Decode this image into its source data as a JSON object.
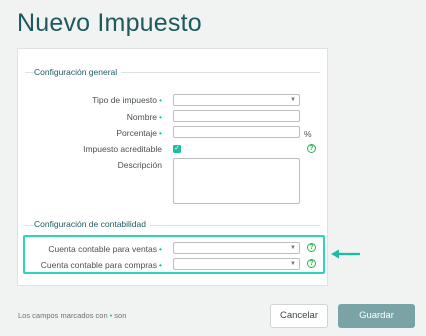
{
  "page": {
    "title": "Nuevo Impuesto"
  },
  "sections": {
    "general": "Configuración general",
    "accounting": "Configuración de contabilidad"
  },
  "fields": {
    "tax_type": {
      "label": "Tipo de impuesto",
      "value": ""
    },
    "name": {
      "label": "Nombre",
      "value": ""
    },
    "percentage": {
      "label": "Porcentaje",
      "value": "",
      "unit": "%"
    },
    "creditable": {
      "label": "Impuesto acreditable",
      "checked": true
    },
    "description": {
      "label": "Descripción",
      "value": ""
    },
    "sales_account": {
      "label": "Cuenta contable para ventas",
      "value": ""
    },
    "purchases_account": {
      "label": "Cuenta contable para compras",
      "value": ""
    }
  },
  "required_marker": "•",
  "footer": {
    "note_prefix": "Los campos marcados con",
    "note_suffix": "son"
  },
  "buttons": {
    "cancel": "Cancelar",
    "save": "Guardar"
  },
  "icons": {
    "help": "?",
    "check": "✓",
    "caret": "▼"
  },
  "colors": {
    "accent": "#19bfa3",
    "title": "#1d5a5e",
    "highlight": "#2fd3b8",
    "save_button": "#7aa3a6"
  }
}
